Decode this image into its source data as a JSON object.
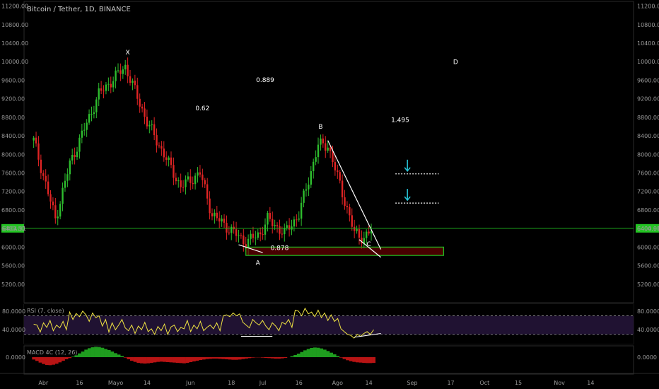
{
  "header": {
    "title": "Bitcoin / Tether, 1D, BINANCE"
  },
  "chart_data": {
    "type": "candlestick",
    "price_axis": {
      "ticks": [
        "11200.00",
        "10800.00",
        "10400.00",
        "10000.00",
        "9600.00",
        "9200.00",
        "8800.00",
        "8400.00",
        "8000.00",
        "7600.00",
        "7200.00",
        "6800.00",
        "6400.00",
        "6000.00",
        "5600.00",
        "5200.00"
      ],
      "range": [
        4800,
        11300
      ]
    },
    "current_price": "6404.91",
    "price_line_color": "#22c322",
    "x_axis_labels": [
      "Abr",
      "16",
      "Mayo",
      "14",
      "Jun",
      "18",
      "Jul",
      "16",
      "Ago",
      "14",
      "Sep",
      "17",
      "Oct",
      "15",
      "Nov",
      "14"
    ],
    "key_closes": [
      [
        "2018-03-28",
        8300
      ],
      [
        "2018-04-06",
        6600
      ],
      [
        "2018-04-12",
        7800
      ],
      [
        "2018-04-24",
        9300
      ],
      [
        "2018-05-05",
        9900
      ],
      [
        "2018-05-14",
        8700
      ],
      [
        "2018-05-28",
        7300
      ],
      [
        "2018-06-05",
        7600
      ],
      [
        "2018-06-10",
        6700
      ],
      [
        "2018-06-24",
        6100
      ],
      [
        "2018-06-30",
        6300
      ],
      [
        "2018-07-03",
        6600
      ],
      [
        "2018-07-10",
        6300
      ],
      [
        "2018-07-16",
        6700
      ],
      [
        "2018-07-24",
        8200
      ],
      [
        "2018-07-28",
        8200
      ],
      [
        "2018-08-04",
        7000
      ],
      [
        "2018-08-08",
        6300
      ],
      [
        "2018-08-12",
        6200
      ],
      [
        "2018-08-16",
        6400
      ]
    ],
    "annotations": {
      "points": [
        {
          "label": "X",
          "date": "2018-05-06",
          "price": 10000,
          "side": "above"
        },
        {
          "label": "A",
          "date": "2018-06-29",
          "price": 5800,
          "side": "below"
        },
        {
          "label": "B",
          "date": "2018-07-25",
          "price": 8400,
          "side": "above"
        },
        {
          "label": "C",
          "date": "2018-08-14",
          "price": 6200,
          "side": "below"
        },
        {
          "label": "D",
          "date": "2018-09-19",
          "price": 9950,
          "side": "center"
        }
      ],
      "ratios": [
        {
          "label": "0.62",
          "date": "2018-06-06",
          "price": 8950
        },
        {
          "label": "0.889",
          "date": "2018-07-02",
          "price": 9560
        },
        {
          "label": "1.495",
          "date": "2018-08-27",
          "price": 8700
        },
        {
          "label": "0.878",
          "date": "2018-07-08",
          "price": 5940
        }
      ],
      "zone": {
        "from": "2018-06-24",
        "to": "2018-09-14",
        "low": 5820,
        "high": 6000
      },
      "targets": [
        7580,
        6950
      ]
    },
    "rsi": {
      "label": "RSI (7, close)",
      "ticks": [
        "80.0000",
        "40.0000"
      ],
      "upper": 70,
      "lower": 30,
      "values": [
        52,
        50,
        35,
        55,
        45,
        60,
        38,
        50,
        44,
        58,
        40,
        78,
        62,
        75,
        68,
        80,
        72,
        58,
        76,
        66,
        70,
        48,
        62,
        35,
        55,
        40,
        50,
        62,
        44,
        38,
        50,
        32,
        48,
        40,
        56,
        36,
        42,
        30,
        47,
        38,
        52,
        30,
        46,
        50,
        36,
        45,
        42,
        60,
        36,
        50,
        42,
        58,
        38,
        45,
        50,
        42,
        55,
        38,
        70,
        72,
        68,
        76,
        70,
        74,
        56,
        50,
        44,
        62,
        55,
        50,
        60,
        48,
        40,
        55,
        48,
        38,
        56,
        52,
        62,
        45,
        82,
        80,
        70,
        86,
        74,
        78,
        68,
        82,
        66,
        76,
        60,
        72,
        58,
        64,
        42,
        36,
        30,
        28,
        22,
        30,
        26,
        32,
        36,
        30,
        40
      ]
    },
    "macd": {
      "label": "MACD 4C (12, 26)",
      "ticks": [
        "0.0000"
      ],
      "values": [
        -100,
        -160,
        -230,
        -290,
        -330,
        -340,
        -320,
        -280,
        -220,
        -150,
        -90,
        -40,
        20,
        80,
        160,
        240,
        320,
        380,
        420,
        440,
        430,
        400,
        350,
        300,
        240,
        170,
        110,
        50,
        -20,
        -90,
        -150,
        -200,
        -240,
        -260,
        -270,
        -260,
        -240,
        -220,
        -200,
        -190,
        -200,
        -210,
        -220,
        -230,
        -240,
        -250,
        -260,
        -240,
        -210,
        -180,
        -150,
        -120,
        -100,
        -80,
        -70,
        -60,
        -60,
        -70,
        -80,
        -90,
        -100,
        -110,
        -110,
        -100,
        -80,
        -60,
        -40,
        -20,
        -10,
        -10,
        -20,
        -30,
        -40,
        -50,
        -60,
        -60,
        -50,
        -30,
        0,
        40,
        90,
        150,
        220,
        290,
        350,
        390,
        410,
        400,
        370,
        320,
        260,
        190,
        120,
        50,
        -20,
        -80,
        -130,
        -170,
        -200,
        -220,
        -230,
        -240,
        -250,
        -250,
        -240
      ]
    }
  }
}
